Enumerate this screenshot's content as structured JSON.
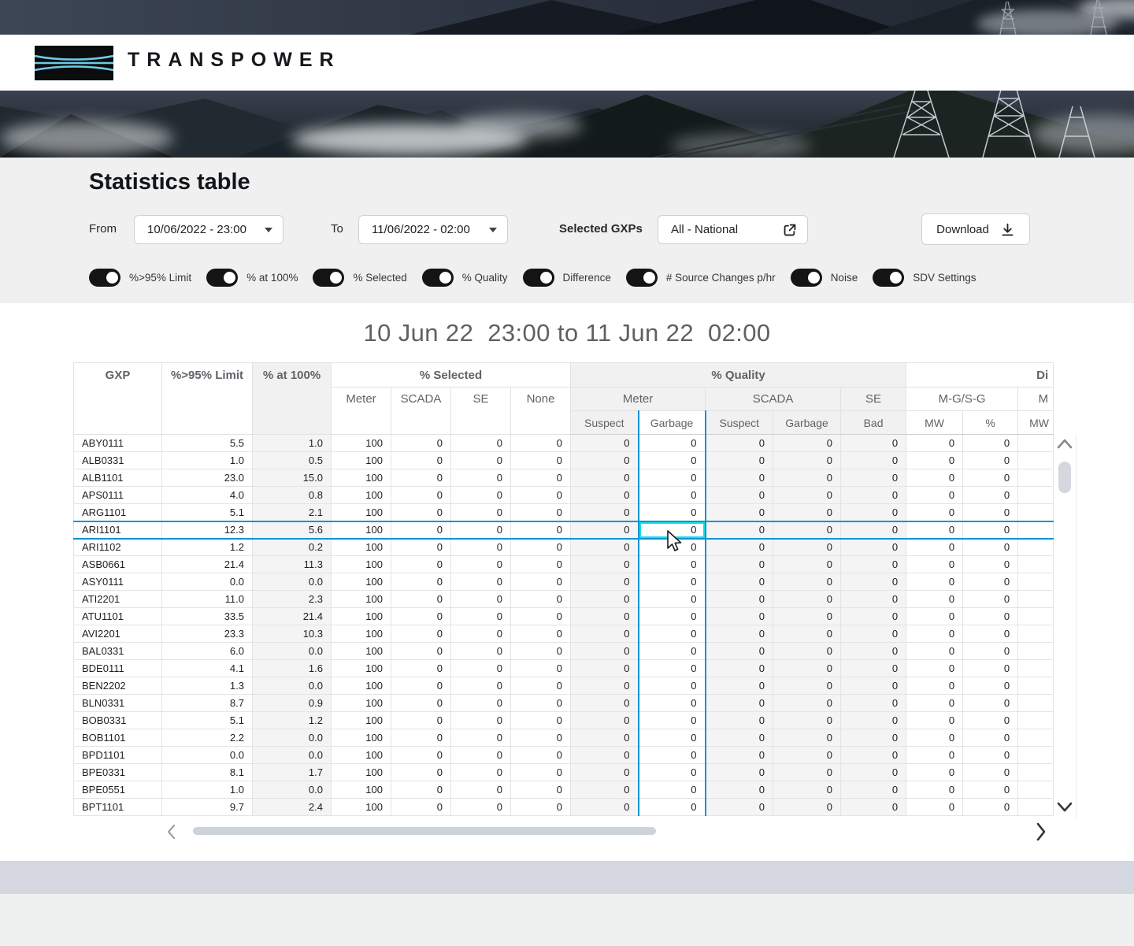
{
  "brand": {
    "name": "TRANSPOWER"
  },
  "page": {
    "heading": "Statistics table",
    "range_title": "10 Jun 22  23:00 to 11 Jun 22  02:00"
  },
  "controls": {
    "from_label": "From",
    "from_value": "10/06/2022 - 23:00",
    "to_label": "To",
    "to_value": "11/06/2022 - 02:00",
    "gxps_label": "Selected GXPs",
    "gxps_value": "All - National",
    "download_label": "Download"
  },
  "toggles": [
    {
      "label": "%>95% Limit",
      "on": true
    },
    {
      "label": "% at 100%",
      "on": true
    },
    {
      "label": "% Selected",
      "on": true
    },
    {
      "label": "% Quality",
      "on": true
    },
    {
      "label": "Difference",
      "on": true
    },
    {
      "label": "# Source Changes p/hr",
      "on": true
    },
    {
      "label": "Noise",
      "on": true
    },
    {
      "label": "SDV Settings",
      "on": true
    }
  ],
  "table": {
    "head": {
      "gxp": "GXP",
      "limit": "%>95% Limit",
      "at100": "% at 100%",
      "selected_group": "% Selected",
      "quality_group": "% Quality",
      "difference_group": "Di",
      "sel_meter": "Meter",
      "sel_scada": "SCADA",
      "sel_se": "SE",
      "sel_none": "None",
      "q_meter": "Meter",
      "q_scada": "SCADA",
      "q_se": "SE",
      "q_meter_suspect": "Suspect",
      "q_meter_garbage": "Garbage",
      "q_scada_suspect": "Suspect",
      "q_scada_garbage": "Garbage",
      "q_se_bad": "Bad",
      "diff_mgsg": "M-G/S-G",
      "diff_next_group": "M",
      "diff_mw": "MW",
      "diff_pct": "%",
      "diff_mw2": "MW"
    },
    "selected_gxp": "ARI1101",
    "selected_column_index": 8,
    "shaded_column_indices": [
      2,
      7,
      9,
      10,
      11
    ],
    "rows": [
      [
        "ABY0111",
        "5.5",
        "1.0",
        "100",
        "0",
        "0",
        "0",
        "0",
        "0",
        "0",
        "0",
        "0",
        "0",
        "0",
        ""
      ],
      [
        "ALB0331",
        "1.0",
        "0.5",
        "100",
        "0",
        "0",
        "0",
        "0",
        "0",
        "0",
        "0",
        "0",
        "0",
        "0",
        ""
      ],
      [
        "ALB1101",
        "23.0",
        "15.0",
        "100",
        "0",
        "0",
        "0",
        "0",
        "0",
        "0",
        "0",
        "0",
        "0",
        "0",
        ""
      ],
      [
        "APS0111",
        "4.0",
        "0.8",
        "100",
        "0",
        "0",
        "0",
        "0",
        "0",
        "0",
        "0",
        "0",
        "0",
        "0",
        ""
      ],
      [
        "ARG1101",
        "5.1",
        "2.1",
        "100",
        "0",
        "0",
        "0",
        "0",
        "0",
        "0",
        "0",
        "0",
        "0",
        "0",
        ""
      ],
      [
        "ARI1101",
        "12.3",
        "5.6",
        "100",
        "0",
        "0",
        "0",
        "0",
        "0",
        "0",
        "0",
        "0",
        "0",
        "0",
        ""
      ],
      [
        "ARI1102",
        "1.2",
        "0.2",
        "100",
        "0",
        "0",
        "0",
        "0",
        "0",
        "0",
        "0",
        "0",
        "0",
        "0",
        ""
      ],
      [
        "ASB0661",
        "21.4",
        "11.3",
        "100",
        "0",
        "0",
        "0",
        "0",
        "0",
        "0",
        "0",
        "0",
        "0",
        "0",
        ""
      ],
      [
        "ASY0111",
        "0.0",
        "0.0",
        "100",
        "0",
        "0",
        "0",
        "0",
        "0",
        "0",
        "0",
        "0",
        "0",
        "0",
        ""
      ],
      [
        "ATI2201",
        "11.0",
        "2.3",
        "100",
        "0",
        "0",
        "0",
        "0",
        "0",
        "0",
        "0",
        "0",
        "0",
        "0",
        ""
      ],
      [
        "ATU1101",
        "33.5",
        "21.4",
        "100",
        "0",
        "0",
        "0",
        "0",
        "0",
        "0",
        "0",
        "0",
        "0",
        "0",
        ""
      ],
      [
        "AVI2201",
        "23.3",
        "10.3",
        "100",
        "0",
        "0",
        "0",
        "0",
        "0",
        "0",
        "0",
        "0",
        "0",
        "0",
        ""
      ],
      [
        "BAL0331",
        "6.0",
        "0.0",
        "100",
        "0",
        "0",
        "0",
        "0",
        "0",
        "0",
        "0",
        "0",
        "0",
        "0",
        ""
      ],
      [
        "BDE0111",
        "4.1",
        "1.6",
        "100",
        "0",
        "0",
        "0",
        "0",
        "0",
        "0",
        "0",
        "0",
        "0",
        "0",
        ""
      ],
      [
        "BEN2202",
        "1.3",
        "0.0",
        "100",
        "0",
        "0",
        "0",
        "0",
        "0",
        "0",
        "0",
        "0",
        "0",
        "0",
        ""
      ],
      [
        "BLN0331",
        "8.7",
        "0.9",
        "100",
        "0",
        "0",
        "0",
        "0",
        "0",
        "0",
        "0",
        "0",
        "0",
        "0",
        ""
      ],
      [
        "BOB0331",
        "5.1",
        "1.2",
        "100",
        "0",
        "0",
        "0",
        "0",
        "0",
        "0",
        "0",
        "0",
        "0",
        "0",
        ""
      ],
      [
        "BOB1101",
        "2.2",
        "0.0",
        "100",
        "0",
        "0",
        "0",
        "0",
        "0",
        "0",
        "0",
        "0",
        "0",
        "0",
        ""
      ],
      [
        "BPD1101",
        "0.0",
        "0.0",
        "100",
        "0",
        "0",
        "0",
        "0",
        "0",
        "0",
        "0",
        "0",
        "0",
        "0",
        ""
      ],
      [
        "BPE0331",
        "8.1",
        "1.7",
        "100",
        "0",
        "0",
        "0",
        "0",
        "0",
        "0",
        "0",
        "0",
        "0",
        "0",
        ""
      ],
      [
        "BPE0551",
        "1.0",
        "0.0",
        "100",
        "0",
        "0",
        "0",
        "0",
        "0",
        "0",
        "0",
        "0",
        "0",
        "0",
        ""
      ],
      [
        "BPT1101",
        "9.7",
        "2.4",
        "100",
        "0",
        "0",
        "0",
        "0",
        "0",
        "0",
        "0",
        "0",
        "0",
        "0",
        ""
      ]
    ]
  },
  "colors": {
    "row_col_highlight": "#0d94d2",
    "cell_highlight": "#19dde4",
    "toggle_on": "#141414",
    "shaded_column": "#f4f4f4",
    "logo_lines": "#6fcbe6"
  }
}
